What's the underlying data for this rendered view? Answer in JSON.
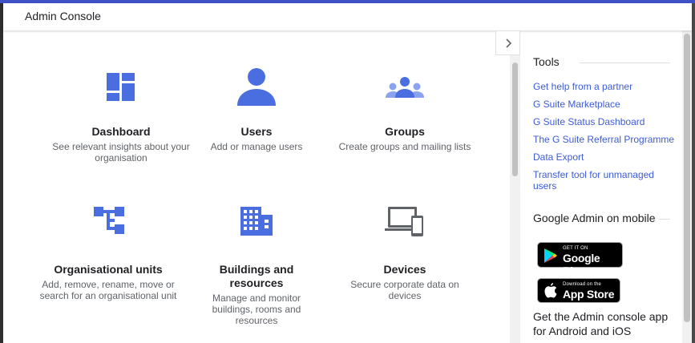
{
  "header": {
    "title": "Admin Console"
  },
  "colors": {
    "accent": "#3f51c7",
    "icon_blue": "#4a6ee0",
    "link": "#3c5bd6"
  },
  "main": {
    "cards": [
      {
        "name": "Dashboard",
        "desc": "See relevant insights about your organisation",
        "icon": "dashboard-icon"
      },
      {
        "name": "Users",
        "desc": "Add or manage users",
        "icon": "user-icon"
      },
      {
        "name": "Groups",
        "desc": "Create groups and mailing lists",
        "icon": "groups-icon"
      },
      {
        "name": "Organisational units",
        "desc": "Add, remove, rename, move or search for an organisational unit",
        "icon": "org-units-icon"
      },
      {
        "name": "Buildings and resources",
        "desc": "Manage and monitor buildings, rooms and resources",
        "icon": "building-icon"
      },
      {
        "name": "Devices",
        "desc": "Secure corporate data on devices",
        "icon": "devices-icon"
      }
    ]
  },
  "side": {
    "tools_title": "Tools",
    "links": [
      "Get help from a partner",
      "G Suite Marketplace",
      "G Suite Status Dashboard",
      "The G Suite Referral Programme",
      "Data Export",
      "Transfer tool for unmanaged users"
    ],
    "mobile_title": "Google Admin on mobile",
    "google_play": {
      "small": "GET IT ON",
      "big": "Google Play"
    },
    "app_store": {
      "small": "Download on the",
      "big": "App Store"
    },
    "app_text": "Get the Admin console app for Android and iOS"
  }
}
